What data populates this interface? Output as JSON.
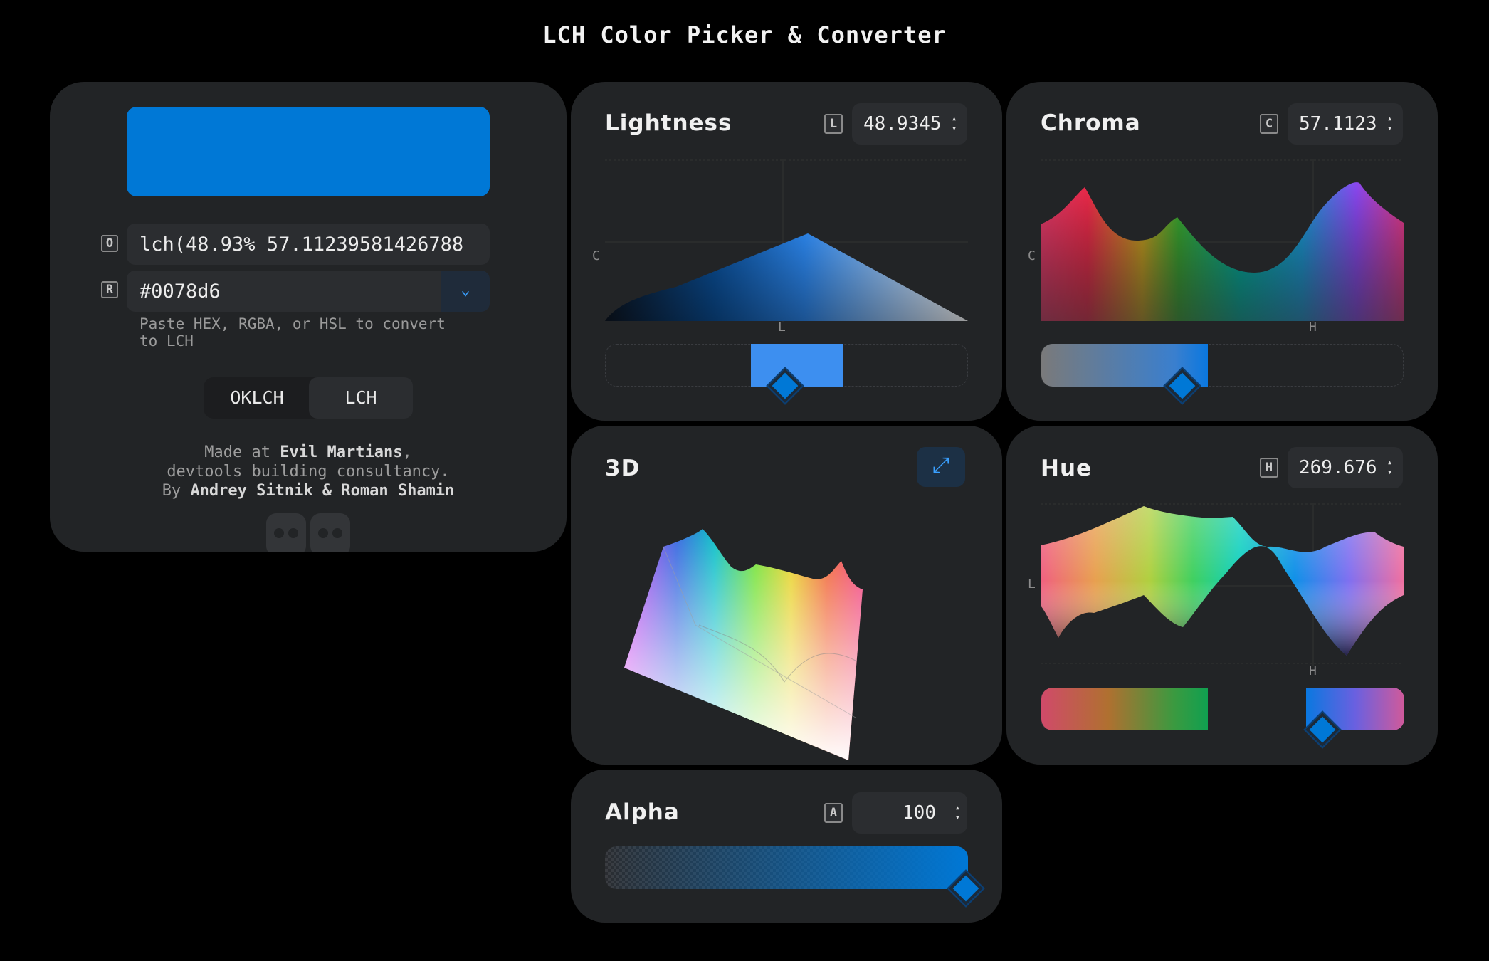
{
  "title": "LCH Color Picker & Converter",
  "color": {
    "swatch": "#0078d6"
  },
  "inputs": {
    "lch_tag": "O",
    "lch_value": "lch(48.93% 57.11239581426788",
    "hex_tag": "R",
    "hex_value": "#0078d6",
    "help": "Paste HEX, RGBA, or HSL to convert to LCH"
  },
  "space_toggle": {
    "options": [
      "OKLCH",
      "LCH"
    ]
  },
  "credits": {
    "line1_prefix": "Made at ",
    "line1_bold": "Evil Martians",
    "line1_suffix": ",",
    "line2": "devtools building consultancy.",
    "line3_prefix": "By ",
    "line3_bold": "Andrey Sitnik & Roman Shamin"
  },
  "lightness": {
    "title": "Lightness",
    "tag": "L",
    "value": "48.9345",
    "x_axis": "L",
    "y_axis": "C"
  },
  "chroma": {
    "title": "Chroma",
    "tag": "C",
    "value": "57.1123",
    "x_axis": "H",
    "y_axis": "C"
  },
  "hue": {
    "title": "Hue",
    "tag": "H",
    "value": "269.676",
    "x_axis": "H",
    "y_axis": "L"
  },
  "three_d": {
    "title": "3D",
    "expand_icon": "expand-icon"
  },
  "alpha": {
    "title": "Alpha",
    "tag": "A",
    "value": "100"
  },
  "colors": {
    "card": "#222426",
    "accent": "#0078d6",
    "link": "#3aa0ff"
  }
}
